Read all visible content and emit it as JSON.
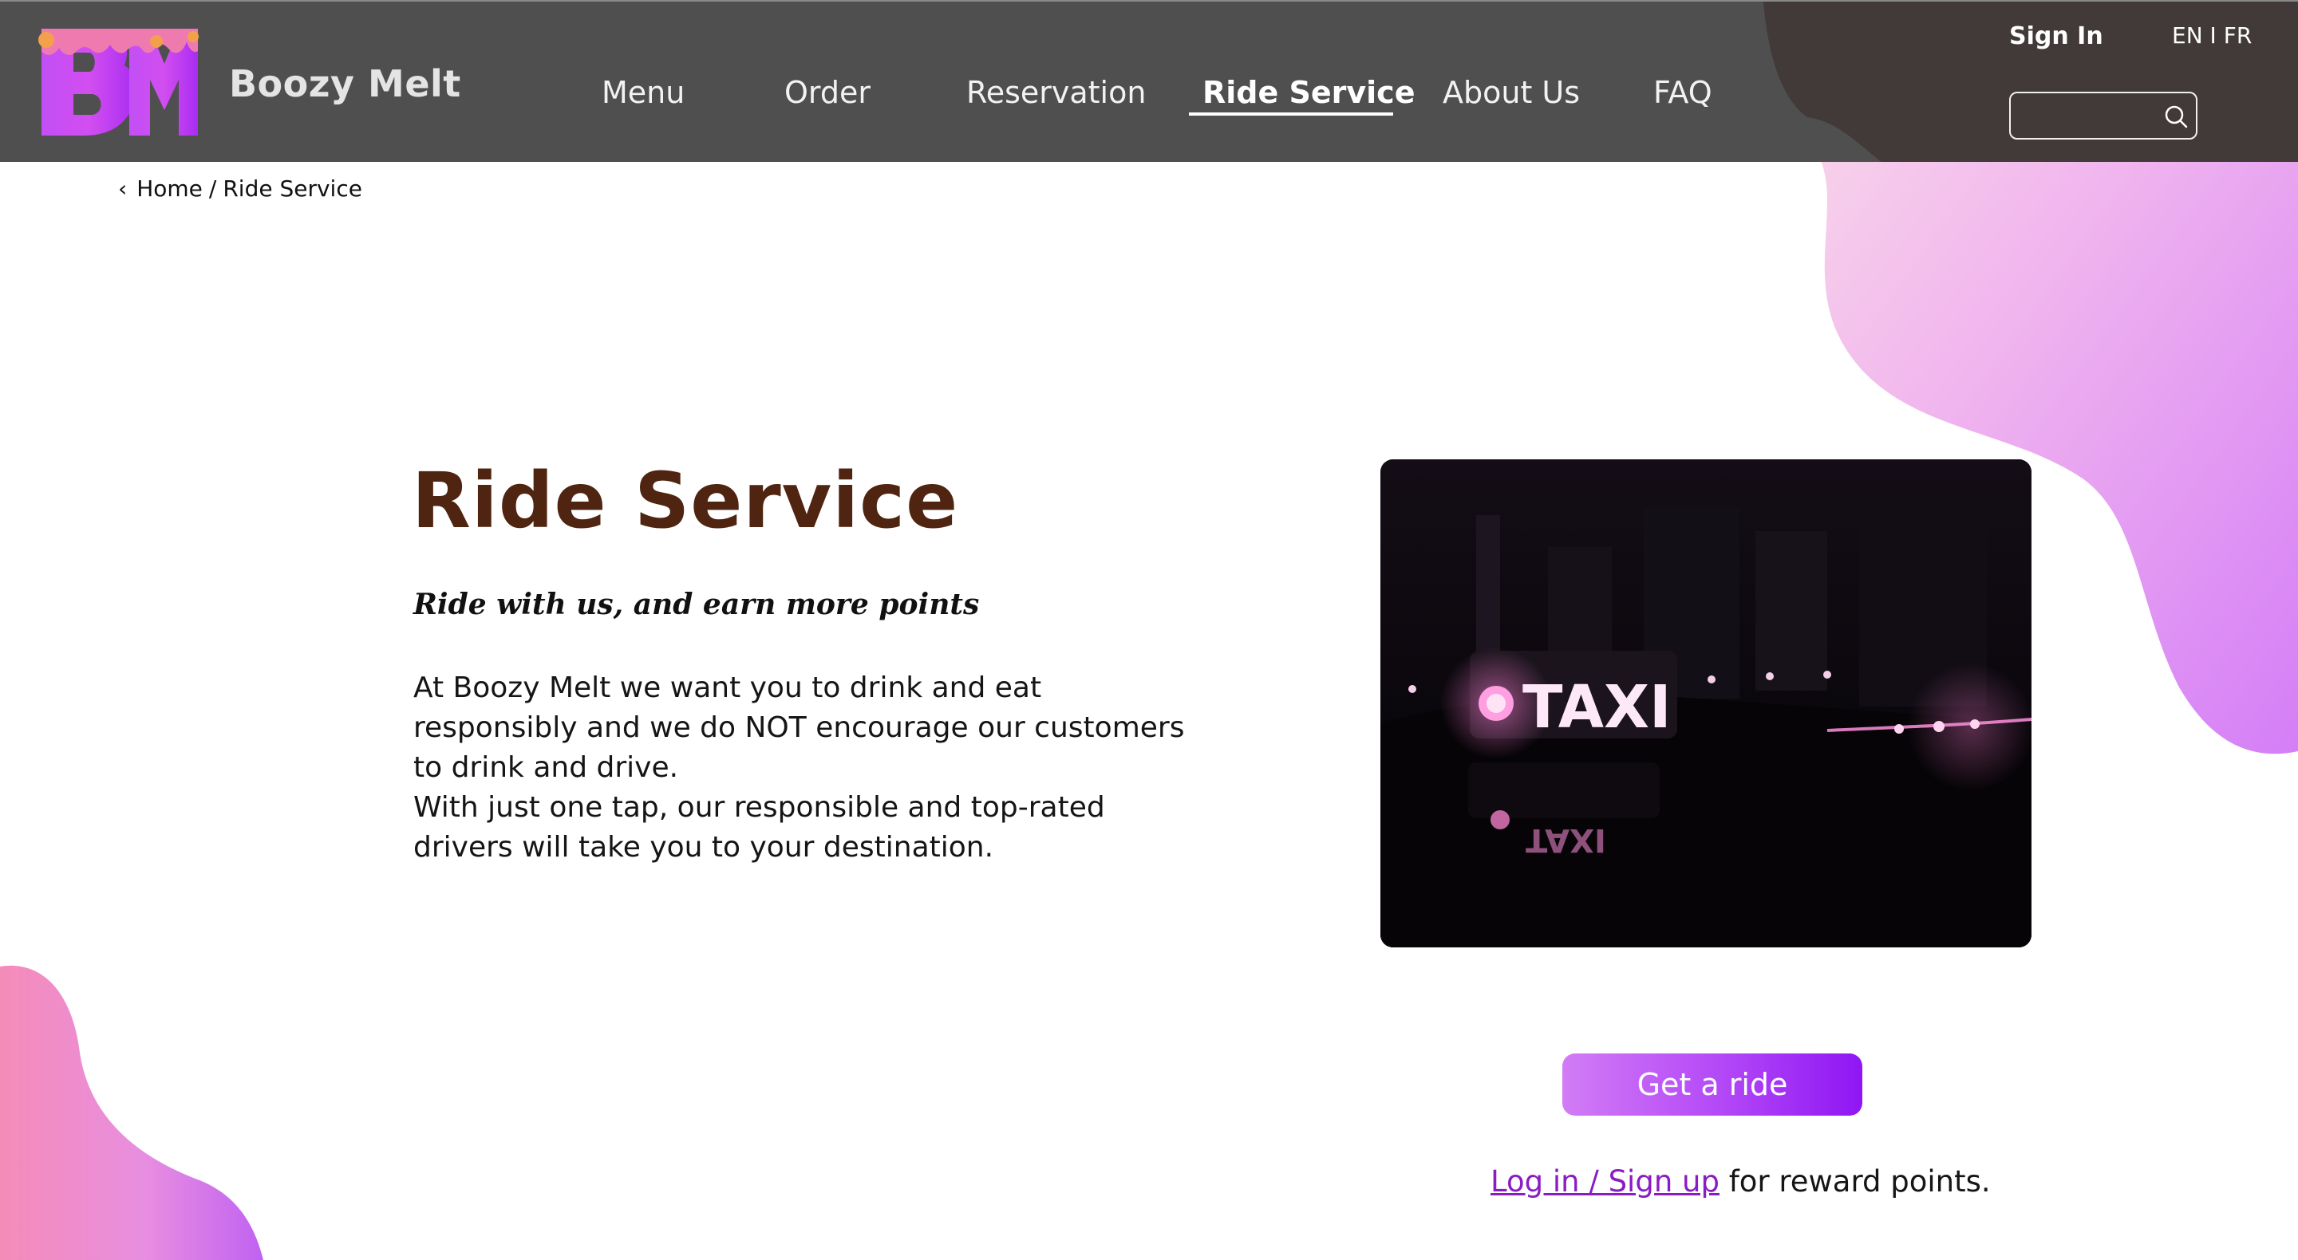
{
  "brand": {
    "name": "Boozy Melt",
    "logo_letters": "BM"
  },
  "nav": {
    "items": [
      {
        "label": "Menu",
        "active": false
      },
      {
        "label": "Order",
        "active": false
      },
      {
        "label": "Reservation",
        "active": false
      },
      {
        "label": "Ride Service",
        "active": true
      },
      {
        "label": "About Us",
        "active": false
      },
      {
        "label": "FAQ",
        "active": false
      }
    ]
  },
  "header": {
    "sign_in_label": "Sign In",
    "lang_en": "EN",
    "lang_sep": "I",
    "lang_fr": "FR",
    "search_placeholder": "",
    "search_value": ""
  },
  "breadcrumb": {
    "back_glyph": "‹",
    "home_label": "Home",
    "separator": "/",
    "current_label": "Ride Service"
  },
  "main": {
    "title": "Ride Service",
    "subtitle": "Ride with us, and earn more points",
    "paragraph_1": "At Boozy Melt we want you to drink and eat responsibly and we do NOT encourage our customers to drink and drive.",
    "paragraph_2": "With just one tap, our responsible and top-rated drivers will take you to your destination."
  },
  "image": {
    "sign_text": "TAXI"
  },
  "cta": {
    "button_label": "Get a ride",
    "login_link": "Log in / Sign up",
    "reward_suffix": " for reward points."
  },
  "colors": {
    "header_bg": "#4f4f4f",
    "title_brown": "#4f2410",
    "accent_purple": "#a22ff6",
    "link_purple": "#8a1cc4",
    "blob_pink": "#f39ad0",
    "blob_violet": "#c470f6"
  }
}
